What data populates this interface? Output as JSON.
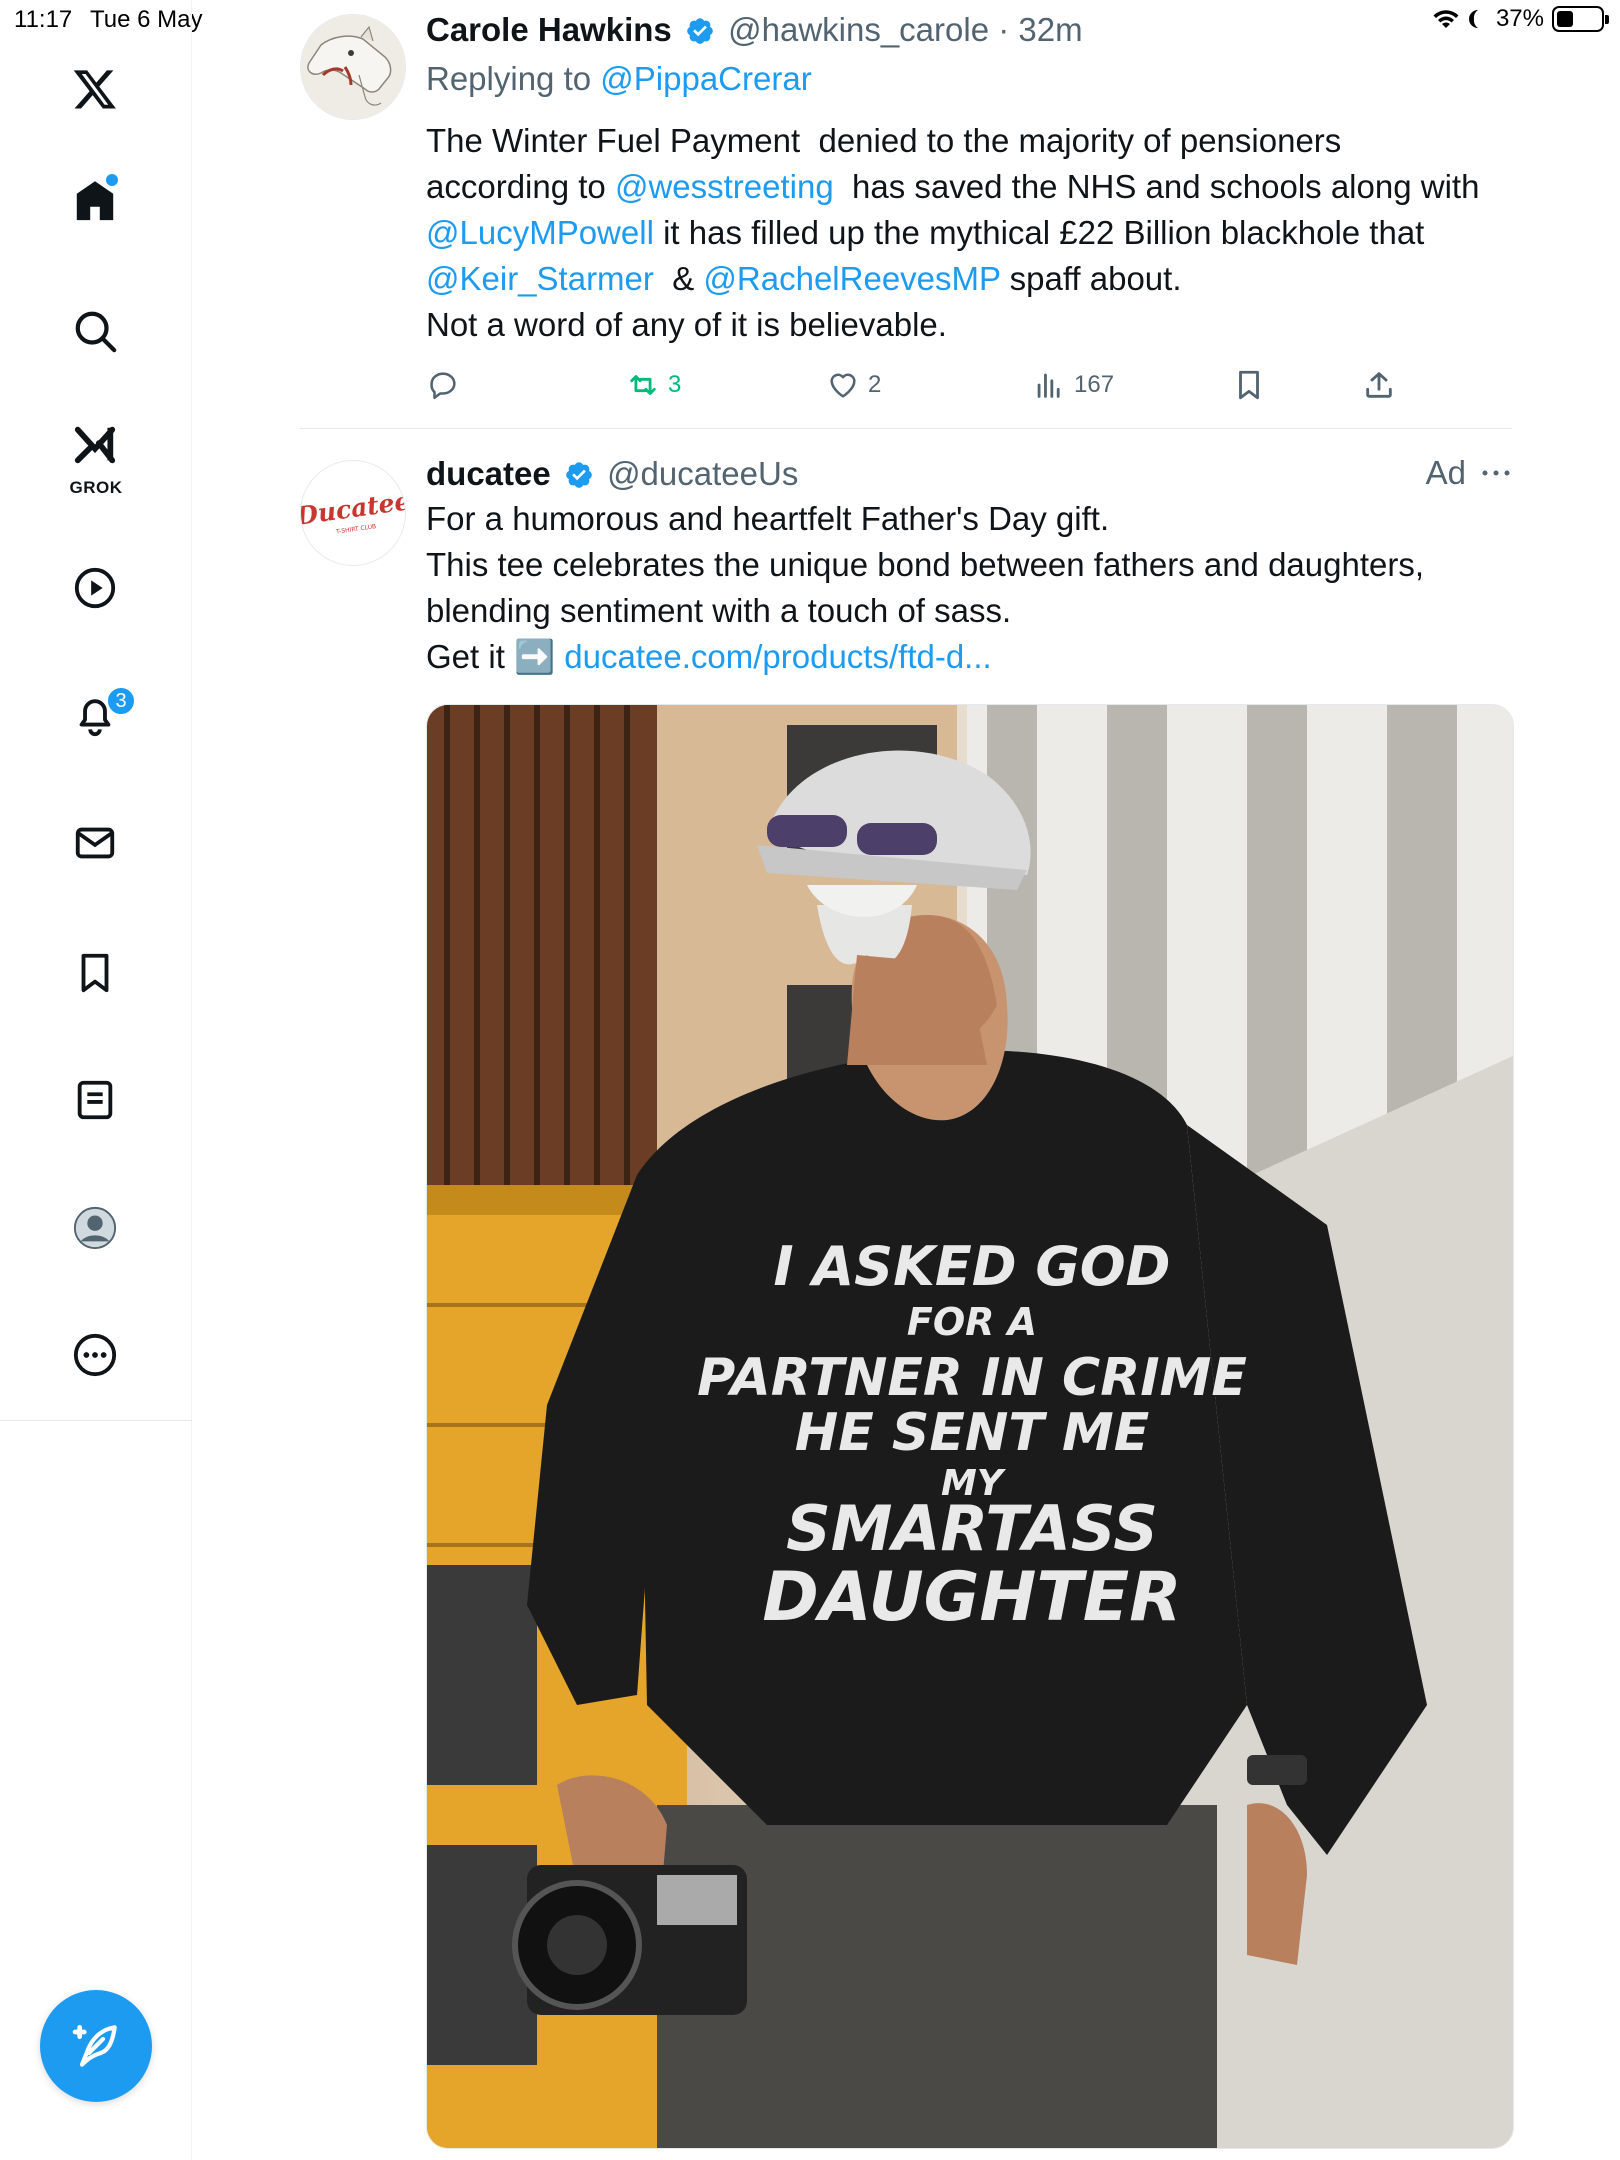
{
  "status_bar": {
    "time": "11:17",
    "date": "Tue 6 May",
    "battery": "37%",
    "battery_level": 0.37
  },
  "sidebar": {
    "grok_label": "GROK",
    "notification_count": "3"
  },
  "tweet1": {
    "name": "Carole Hawkins",
    "handle": "@hawkins_carole",
    "dot": "·",
    "time": "32m",
    "replying_prefix": "Replying to",
    "replying_to": "@PippaCrerar",
    "body": [
      {
        "t": "The Winter Fuel Payment  denied to the majority of pensioners\naccording to "
      },
      {
        "t": "@wesstreeting",
        "link": true
      },
      {
        "t": "  has saved the NHS and schools along with\n"
      },
      {
        "t": "@LucyMPowell",
        "link": true
      },
      {
        "t": " it has filled up the mythical £22 Billion blackhole that\n"
      },
      {
        "t": "@Keir_Starmer",
        "link": true
      },
      {
        "t": "  & "
      },
      {
        "t": "@RachelReevesMP",
        "link": true
      },
      {
        "t": " spaff about.\nNot a word of any of it is believable."
      }
    ],
    "retweets": "3",
    "likes": "2",
    "views": "167"
  },
  "tweet2": {
    "name": "ducatee",
    "handle": "@ducateeUs",
    "ad_label": "Ad",
    "avatar_logo_text": "Ducatee",
    "avatar_logo_sub": "T-SHIRT CLUB",
    "body": [
      {
        "t": "For a humorous and heartfelt Father's Day gift.\nThis tee celebrates the unique bond between fathers and daughters,\nblending sentiment with a touch of sass.\nGet it "
      },
      {
        "t": "➡️",
        "emoji": true
      },
      {
        "t": " "
      },
      {
        "t": "ducatee.com/products/ftd-d...",
        "link": true
      }
    ],
    "shirt_lines": [
      "I ASKED GOD",
      "FOR A",
      "PARTNER IN CRIME",
      "HE SENT ME",
      "MY",
      "SMARTASS",
      "DAUGHTER"
    ]
  },
  "colors": {
    "accent": "#1d9bf0",
    "retweet": "#00ba7c",
    "text": "#0f1419",
    "muted": "#536471"
  },
  "icons": [
    "x-logo-icon",
    "home-icon",
    "search-icon",
    "grok-icon",
    "video-icon",
    "bell-icon",
    "mail-icon",
    "bookmark-icon",
    "lists-icon",
    "profile-icon",
    "more-icon",
    "compose-icon"
  ]
}
